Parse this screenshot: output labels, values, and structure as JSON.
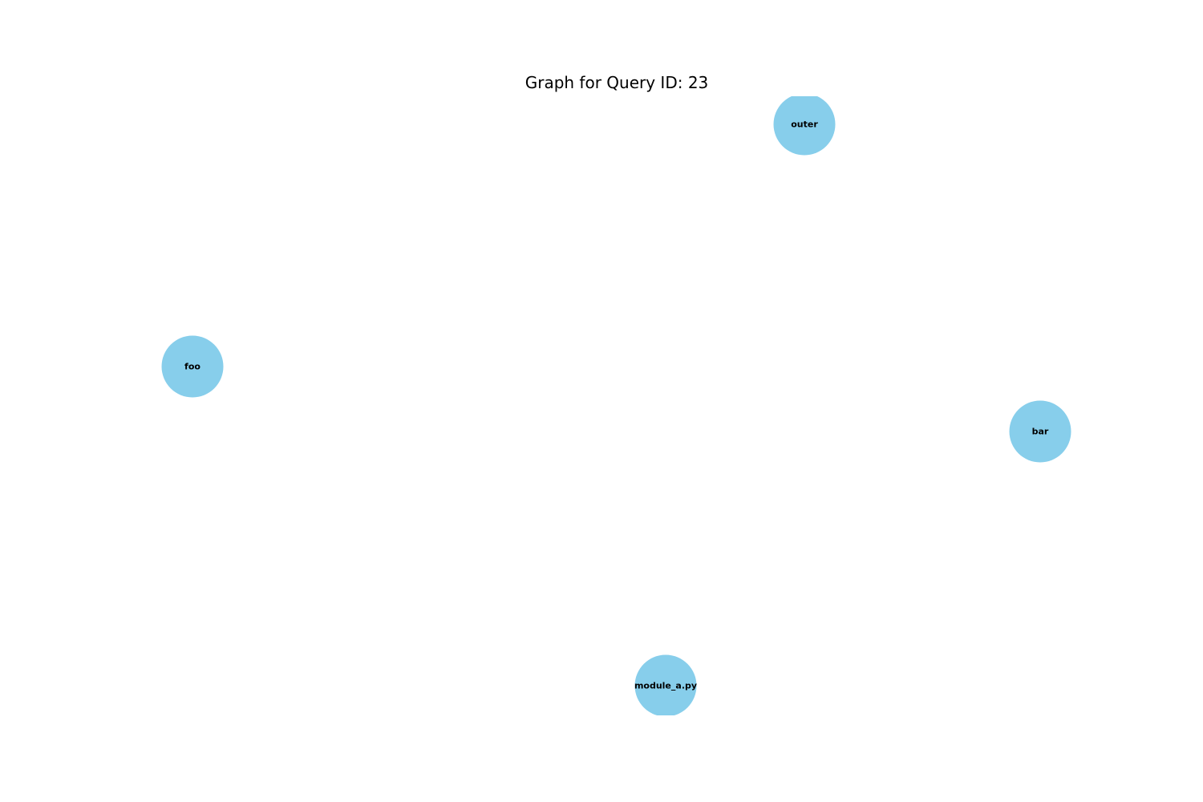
{
  "title": "Graph for Query ID: 23",
  "node_color": "#87ceeb",
  "label_color": "#000000",
  "nodes": [
    {
      "id": "outer",
      "label": "outer"
    },
    {
      "id": "foo",
      "label": "foo"
    },
    {
      "id": "bar",
      "label": "bar"
    },
    {
      "id": "module_a.py",
      "label": "module_a.py"
    }
  ],
  "edges": []
}
